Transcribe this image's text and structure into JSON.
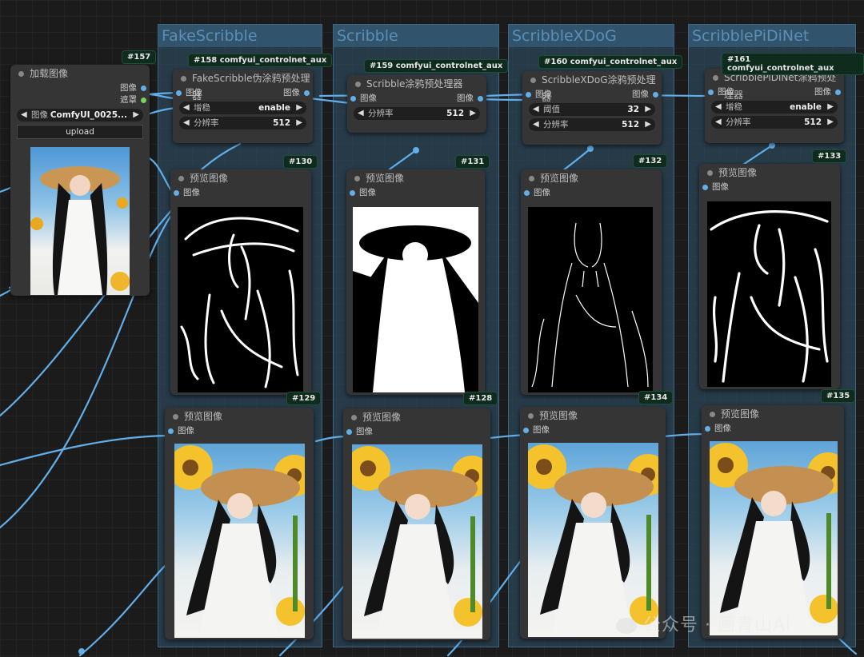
{
  "groups": [
    {
      "title": "FakeScribble"
    },
    {
      "title": "Scribble"
    },
    {
      "title": "ScribbleXDoG"
    },
    {
      "title": "ScribblePiDiNet"
    }
  ],
  "load_node": {
    "badge": "#157",
    "title": "加载图像",
    "outputs": [
      "图像",
      "遮罩"
    ],
    "image_widget": {
      "name": "图像",
      "value": "ComfyUI_0025..."
    },
    "upload_label": "upload"
  },
  "preprocessors": [
    {
      "badge": "#158 comfyui_controlnet_aux",
      "title": "FakeScribble伪涂鸦预处理器",
      "input": "图像",
      "output": "图像",
      "widgets": [
        {
          "name": "增稳",
          "value": "enable"
        },
        {
          "name": "分辨率",
          "value": "512"
        }
      ]
    },
    {
      "badge": "#159 comfyui_controlnet_aux",
      "title": "Scribble涂鸦预处理器",
      "input": "图像",
      "output": "图像",
      "widgets": [
        {
          "name": "分辨率",
          "value": "512"
        }
      ]
    },
    {
      "badge": "#160 comfyui_controlnet_aux",
      "title": "ScribbleXDoG涂鸦预处理器",
      "input": "图像",
      "output": "图像",
      "widgets": [
        {
          "name": "阈值",
          "value": "32"
        },
        {
          "name": "分辨率",
          "value": "512"
        }
      ]
    },
    {
      "badge": "#161 comfyui_controlnet_aux",
      "title": "ScribblePiDiNet涂鸦预处理器",
      "input": "图像",
      "output": "图像",
      "widgets": [
        {
          "name": "增稳",
          "value": "enable"
        },
        {
          "name": "分辨率",
          "value": "512"
        }
      ]
    }
  ],
  "preview_nodes_scribble": [
    {
      "badge": "#130",
      "title": "预览图像",
      "input": "图像"
    },
    {
      "badge": "#131",
      "title": "预览图像",
      "input": "图像"
    },
    {
      "badge": "#132",
      "title": "预览图像",
      "input": "图像"
    },
    {
      "badge": "#133",
      "title": "预览图像",
      "input": "图像"
    }
  ],
  "preview_nodes_color": [
    {
      "badge": "#129",
      "title": "预览图像",
      "input": "图像"
    },
    {
      "badge": "#128",
      "title": "预览图像",
      "input": "图像"
    },
    {
      "badge": "#134",
      "title": "预览图像",
      "input": "图像"
    },
    {
      "badge": "#135",
      "title": "预览图像",
      "input": "图像"
    }
  ],
  "watermark": "公众号 · 画青山Ai",
  "colors": {
    "canvas": "#1b1b1c",
    "node": "#353535",
    "wire": "#62aee8",
    "group": "#30546e",
    "badge": "#0f2b1e"
  }
}
